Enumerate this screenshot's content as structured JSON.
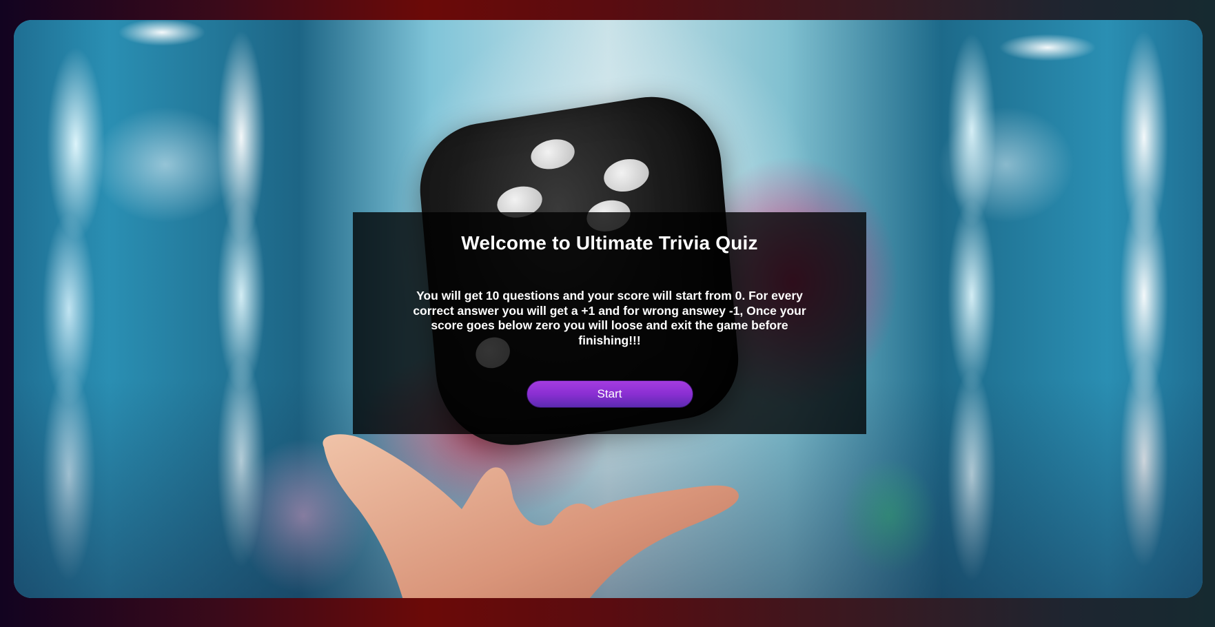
{
  "quiz": {
    "title": "Welcome to Ultimate Trivia Quiz",
    "description": "You will get 10 questions and your score will start from 0. For every correct answer you will get a +1 and for wrong answey -1, Once your score goes below zero you will loose and exit the game before finishing!!!",
    "start_label": "Start"
  },
  "colors": {
    "button_top": "#a43ce0",
    "button_bottom": "#5b2ab0",
    "panel_overlay": "rgba(0,0,0,0.78)"
  },
  "icons": {
    "background": "dice-hand-photo"
  }
}
